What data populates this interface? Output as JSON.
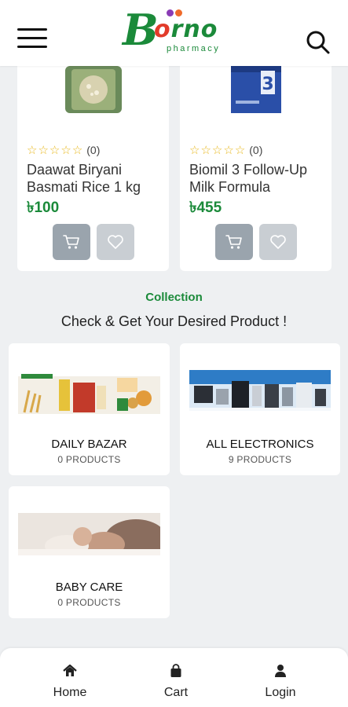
{
  "header": {
    "logo_b": "B",
    "logo_orno_a": "",
    "logo_orno_o": "o",
    "logo_orno_rest": "rno",
    "logo_sub": "pharmacy",
    "menu_icon": "hamburger-menu-icon",
    "search_icon": "search-icon"
  },
  "products": [
    {
      "rating_count": "(0)",
      "name": "Daawat Biryani Basmati Rice 1 kg",
      "price": "৳100"
    },
    {
      "rating_count": "(0)",
      "name": "Biomil 3 Follow-Up Milk Formula",
      "price": "৳455"
    }
  ],
  "collection": {
    "tag": "Collection",
    "heading": "Check & Get Your Desired Product !"
  },
  "categories": [
    {
      "name": "DAILY BAZAR",
      "count": "0 PRODUCTS"
    },
    {
      "name": "ALL ELECTRONICS",
      "count": "9 PRODUCTS"
    },
    {
      "name": "BABY CARE",
      "count": "0 PRODUCTS"
    }
  ],
  "bottom_nav": {
    "home": "Home",
    "cart": "Cart",
    "login": "Login"
  },
  "colors": {
    "brand_green": "#1b8a3a",
    "star_yellow": "#e8b81d",
    "cart_button": "#9aa4ad",
    "wish_button": "#c9ced3",
    "page_bg": "#eef0f2"
  }
}
